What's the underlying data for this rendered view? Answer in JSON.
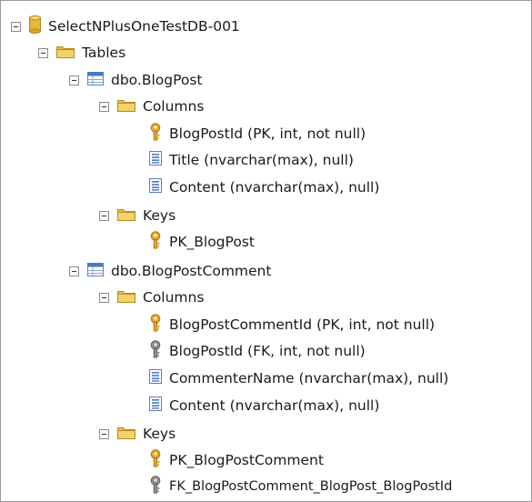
{
  "tree": {
    "database": "SelectNPlusOneTestDB-001",
    "tables_folder": "Tables",
    "tables": [
      {
        "name": "dbo.BlogPost",
        "columns_folder": "Columns",
        "columns": [
          {
            "label": "BlogPostId (PK, int, not null)",
            "icon": "primary-key-icon"
          },
          {
            "label": "Title (nvarchar(max), null)",
            "icon": "column-icon"
          },
          {
            "label": "Content (nvarchar(max), null)",
            "icon": "column-icon"
          }
        ],
        "keys_folder": "Keys",
        "keys": [
          {
            "label": "PK_BlogPost",
            "icon": "primary-key-icon"
          }
        ]
      },
      {
        "name": "dbo.BlogPostComment",
        "columns_folder": "Columns",
        "columns": [
          {
            "label": "BlogPostCommentId (PK, int, not null)",
            "icon": "primary-key-icon"
          },
          {
            "label": "BlogPostId (FK, int, not null)",
            "icon": "foreign-key-icon"
          },
          {
            "label": "CommenterName (nvarchar(max), null)",
            "icon": "column-icon"
          },
          {
            "label": "Content (nvarchar(max), null)",
            "icon": "column-icon"
          }
        ],
        "keys_folder": "Keys",
        "keys": [
          {
            "label": "PK_BlogPostComment",
            "icon": "primary-key-icon"
          },
          {
            "label": "FK_BlogPostComment_BlogPost_BlogPostId",
            "icon": "foreign-key-icon"
          }
        ]
      }
    ]
  },
  "colors": {
    "folder": "#e8c24a",
    "database": "#e6b93a",
    "table_header": "#4a78c0",
    "primary_key": "#e4a82a",
    "foreign_key": "#8f8f8f"
  }
}
